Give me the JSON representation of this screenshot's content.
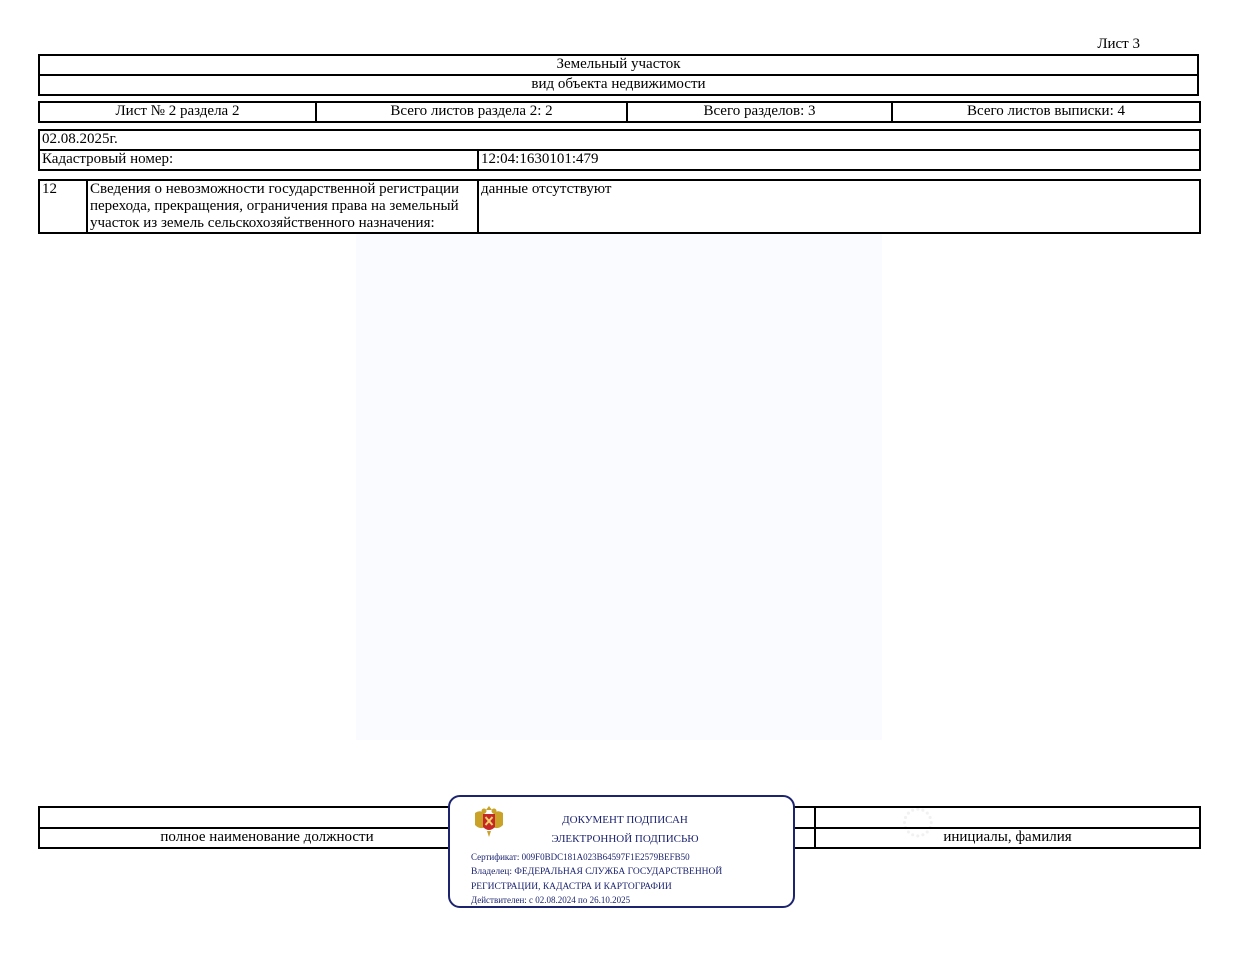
{
  "header": {
    "sheet_label": "Лист 3",
    "object_name": "Земельный участок",
    "object_type_caption": "вид объекта недвижимости"
  },
  "meta_row": {
    "sheet_of_section": "Лист № 2 раздела 2",
    "section_sheets_total": "Всего листов раздела 2: 2",
    "sections_total": "Всего разделов: 3",
    "extract_sheets_total": "Всего листов выписки: 4"
  },
  "date": "02.08.2025г.",
  "cadastral": {
    "label": "Кадастровый номер:",
    "value": "12:04:1630101:479"
  },
  "record": {
    "number": "12",
    "description": "Сведения о невозможности государственной регистрации перехода, прекращения, ограничения права на земельный участок из земель сельскохозяйственного назначения:",
    "value": "данные отсутствуют"
  },
  "signature_row": {
    "position_caption": "полное наименование должности",
    "name_caption": "инициалы, фамилия"
  },
  "stamp": {
    "title_line1": "ДОКУМЕНТ ПОДПИСАН",
    "title_line2": "ЭЛЕКТРОННОЙ ПОДПИСЬЮ",
    "certificate": "Сертификат: 009F0BDC181A023B64597F1E2579BEFB50",
    "owner_line1": "Владелец: ФЕДЕРАЛЬНАЯ СЛУЖБА ГОСУДАРСТВЕННОЙ",
    "owner_line2": "РЕГИСТРАЦИИ, КАДАСТРА И КАРТОГРАФИИ",
    "validity": "Действителен: с 02.08.2024 по 26.10.2025",
    "emblem_icon": "coat-of-arms-icon",
    "color": "#1c2470"
  }
}
